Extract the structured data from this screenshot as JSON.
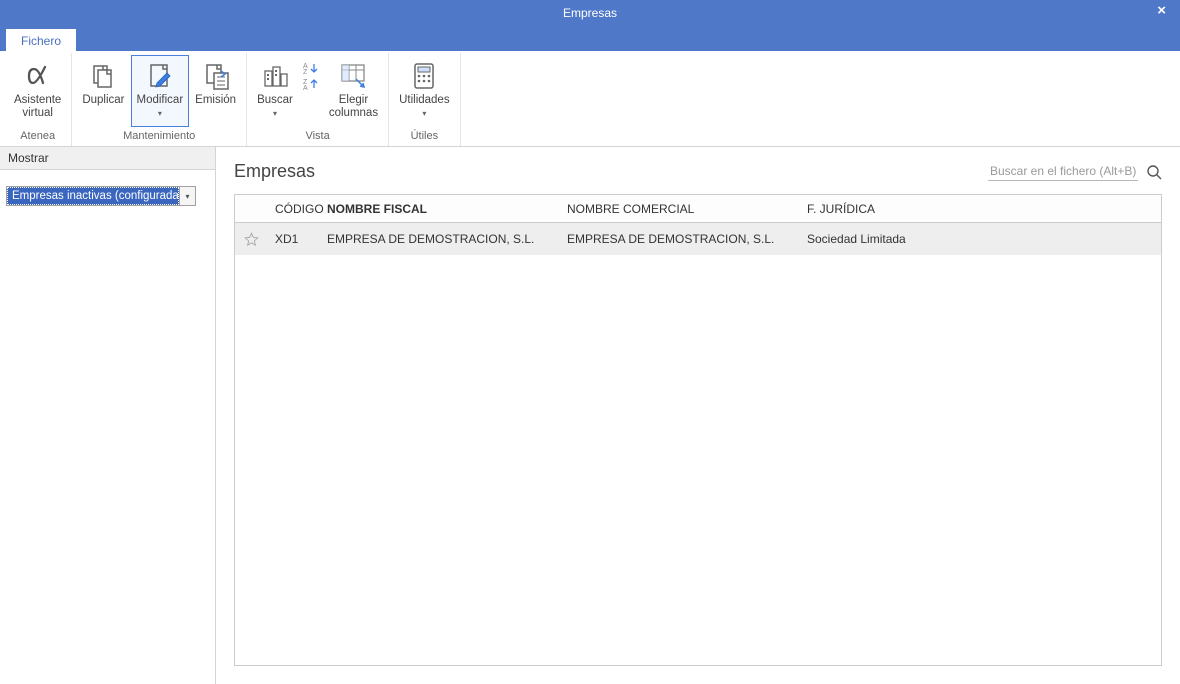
{
  "window": {
    "title": "Empresas",
    "close_label": "×"
  },
  "tabs": {
    "fichero": "Fichero"
  },
  "ribbon": {
    "atenea": {
      "label_line1": "Asistente",
      "label_line2": "virtual",
      "group": "Atenea"
    },
    "mantenimiento": {
      "duplicar": "Duplicar",
      "modificar": "Modificar",
      "emision": "Emisión",
      "group": "Mantenimiento"
    },
    "vista": {
      "buscar": "Buscar",
      "elegir_line1": "Elegir",
      "elegir_line2": "columnas",
      "group": "Vista"
    },
    "utiles": {
      "utilidades": "Utilidades",
      "group": "Útiles"
    }
  },
  "sidebar": {
    "header": "Mostrar",
    "combo_value": "Empresas inactivas (configuradas)"
  },
  "main": {
    "title": "Empresas",
    "search_placeholder": "Buscar en el fichero (Alt+B)"
  },
  "table": {
    "columns": {
      "codigo": "CÓDIGO",
      "nombre_fiscal": "NOMBRE FISCAL",
      "nombre_comercial": "NOMBRE COMERCIAL",
      "f_juridica": "F. JURÍDICA"
    },
    "rows": [
      {
        "codigo": "XD1",
        "nombre_fiscal": "EMPRESA DE DEMOSTRACION, S.L.",
        "nombre_comercial": "EMPRESA DE DEMOSTRACION, S.L.",
        "f_juridica": "Sociedad Limitada"
      }
    ]
  }
}
